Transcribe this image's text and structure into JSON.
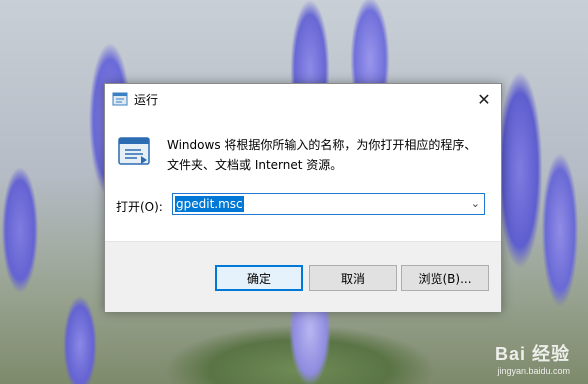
{
  "dialog": {
    "title": "运行",
    "close_symbol": "✕",
    "description": "Windows 将根据你所输入的名称，为你打开相应的程序、文件夹、文档或 Internet 资源。",
    "open_label": "打开(O):",
    "input_value": "gpedit.msc",
    "dropdown_icon": "chevron-down-icon",
    "buttons": {
      "ok": "确定",
      "cancel": "取消",
      "browse": "浏览(B)..."
    }
  },
  "watermark": {
    "main": "Bai 经验",
    "sub": "jingyan.baidu.com"
  },
  "colors": {
    "accent": "#0078d7",
    "footer_bg": "#f0f0f0",
    "button_bg": "#e1e1e1"
  }
}
